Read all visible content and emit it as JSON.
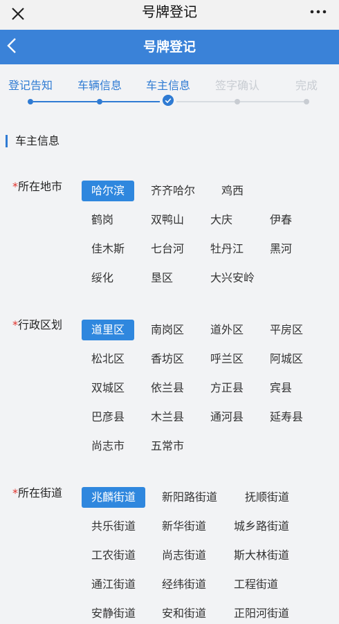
{
  "window": {
    "title": "号牌登记"
  },
  "navbar": {
    "title": "号牌登记"
  },
  "steps": [
    {
      "label": "登记告知",
      "state": "done"
    },
    {
      "label": "车辆信息",
      "state": "done"
    },
    {
      "label": "车主信息",
      "state": "current"
    },
    {
      "label": "签字确认",
      "state": "todo"
    },
    {
      "label": "完成",
      "state": "todo"
    }
  ],
  "section": {
    "title": "车主信息"
  },
  "city": {
    "required_mark": "*",
    "label": "所在地市",
    "selected": "哈尔滨",
    "options": [
      "哈尔滨",
      "齐齐哈尔",
      "鸡西",
      "鹤岗",
      "双鸭山",
      "大庆",
      "伊春",
      "佳木斯",
      "七台河",
      "牡丹江",
      "黑河",
      "绥化",
      "垦区",
      "大兴安岭"
    ]
  },
  "district": {
    "required_mark": "*",
    "label": "行政区划",
    "selected": "道里区",
    "options": [
      "道里区",
      "南岗区",
      "道外区",
      "平房区",
      "松北区",
      "香坊区",
      "呼兰区",
      "阿城区",
      "双城区",
      "依兰县",
      "方正县",
      "宾县",
      "巴彦县",
      "木兰县",
      "通河县",
      "延寿县",
      "尚志市",
      "五常市"
    ]
  },
  "street": {
    "required_mark": "*",
    "label": "所在街道",
    "selected": "兆麟街道",
    "options": [
      "兆麟街道",
      "新阳路街道",
      "抚顺街道",
      "共乐街道",
      "新华街道",
      "城乡路街道",
      "工农街道",
      "尚志街道",
      "斯大林街道",
      "通江街道",
      "经纬街道",
      "工程街道",
      "安静街道",
      "安和街道",
      "正阳河街道"
    ]
  },
  "colors": {
    "accent": "#2f7bd3",
    "navbar": "#3a82d8",
    "required": "#e0322b",
    "inactive": "#c8ccd2"
  },
  "icons": {
    "close": "close-icon",
    "more": "more-icon",
    "back": "back-icon",
    "check": "check-icon"
  }
}
